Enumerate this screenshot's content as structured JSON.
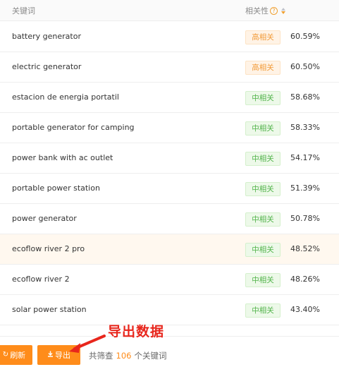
{
  "header": {
    "keyword_col": "关键词",
    "relevance_col": "相关性",
    "help_glyph": "?"
  },
  "rows": [
    {
      "keyword": "battery generator",
      "badge": "高相关",
      "level": "high",
      "percent": "60.59%"
    },
    {
      "keyword": "electric generator",
      "badge": "高相关",
      "level": "high",
      "percent": "60.50%"
    },
    {
      "keyword": "estacion de energia portatil",
      "badge": "中相关",
      "level": "mid",
      "percent": "58.68%"
    },
    {
      "keyword": "portable generator for camping",
      "badge": "中相关",
      "level": "mid",
      "percent": "58.33%"
    },
    {
      "keyword": "power bank with ac outlet",
      "badge": "中相关",
      "level": "mid",
      "percent": "54.17%"
    },
    {
      "keyword": "portable power station",
      "badge": "中相关",
      "level": "mid",
      "percent": "51.39%"
    },
    {
      "keyword": "power generator",
      "badge": "中相关",
      "level": "mid",
      "percent": "50.78%"
    },
    {
      "keyword": "ecoflow river 2 pro",
      "badge": "中相关",
      "level": "mid",
      "percent": "48.52%",
      "highlight": true
    },
    {
      "keyword": "ecoflow river 2",
      "badge": "中相关",
      "level": "mid",
      "percent": "48.26%"
    },
    {
      "keyword": "solar power station",
      "badge": "中相关",
      "level": "mid",
      "percent": "43.40%"
    }
  ],
  "footer": {
    "refresh_label": "刷新",
    "export_label": "导出",
    "summary_prefix": "共筛查",
    "summary_count": "106",
    "summary_suffix": "个关键词"
  },
  "annotation": {
    "text": "导出数据"
  },
  "colors": {
    "accent": "#ff8c1a",
    "high_text": "#f29b38",
    "mid_text": "#52b44b",
    "annotation_red": "#e8261c"
  },
  "icons": {
    "refresh": "refresh-icon",
    "export": "download-icon",
    "help": "help-circle-icon",
    "sort": "sort-icon"
  }
}
